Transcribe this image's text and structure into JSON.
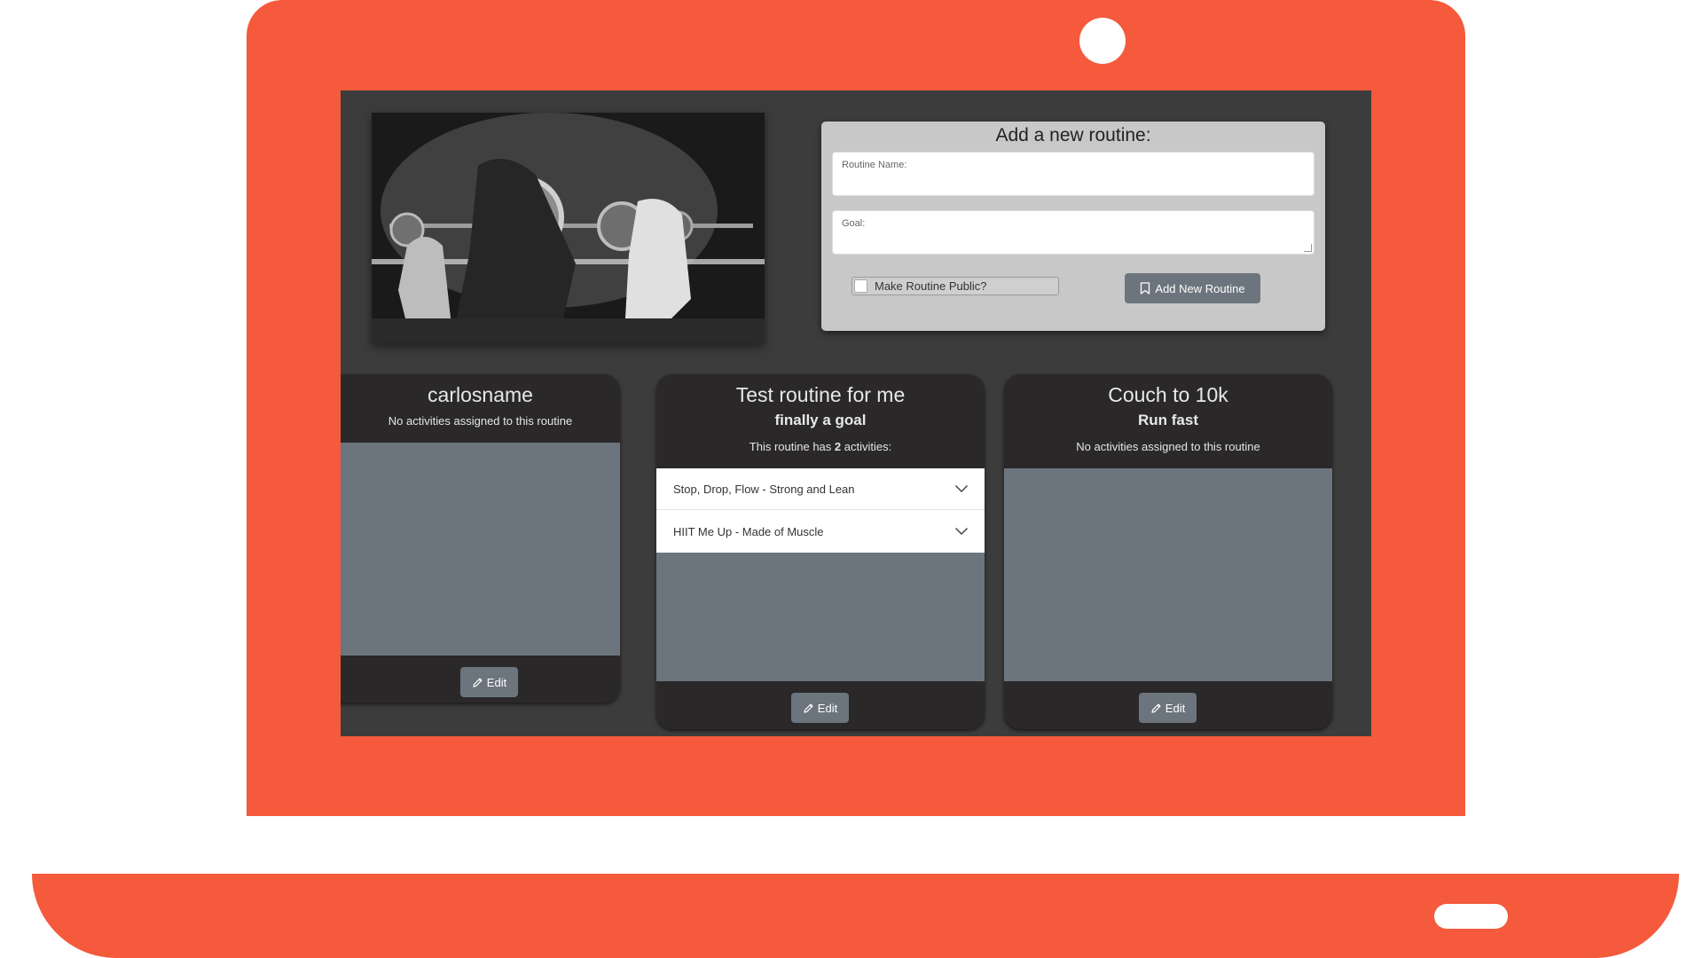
{
  "form": {
    "title": "Add a new routine:",
    "routine_name_label": "Routine Name:",
    "routine_name_value": "",
    "goal_label": "Goal:",
    "goal_value": "",
    "public_label": "Make Routine Public?",
    "public_checked": false,
    "add_button_label": "Add New Routine"
  },
  "routines": [
    {
      "name": "carlosname",
      "goal": "",
      "activity_note": "No activities assigned to this routine",
      "activities": [],
      "edit_label": "Edit"
    },
    {
      "name": "Test routine for me",
      "goal": "finally a goal",
      "activity_note_prefix": "This routine has ",
      "activity_count": "2",
      "activity_note_suffix": " activities:",
      "activities": [
        {
          "label": "Stop, Drop, Flow - Strong and Lean"
        },
        {
          "label": "HIIT Me Up - Made of Muscle"
        }
      ],
      "edit_label": "Edit"
    },
    {
      "name": "Couch to 10k",
      "goal": "Run fast",
      "activity_note": "No activities assigned to this routine",
      "activities": [],
      "edit_label": "Edit"
    }
  ],
  "colors": {
    "laptop_frame": "#f45a3b",
    "screen_bg": "#3d3c3d",
    "card_bg": "#2a2829",
    "button_bg": "#6c757d",
    "form_bg": "#c8c8c8"
  },
  "icons": {
    "add_button": "bookmark-icon",
    "edit_button": "pencil-icon",
    "activity_toggle": "chevron-down-icon"
  }
}
